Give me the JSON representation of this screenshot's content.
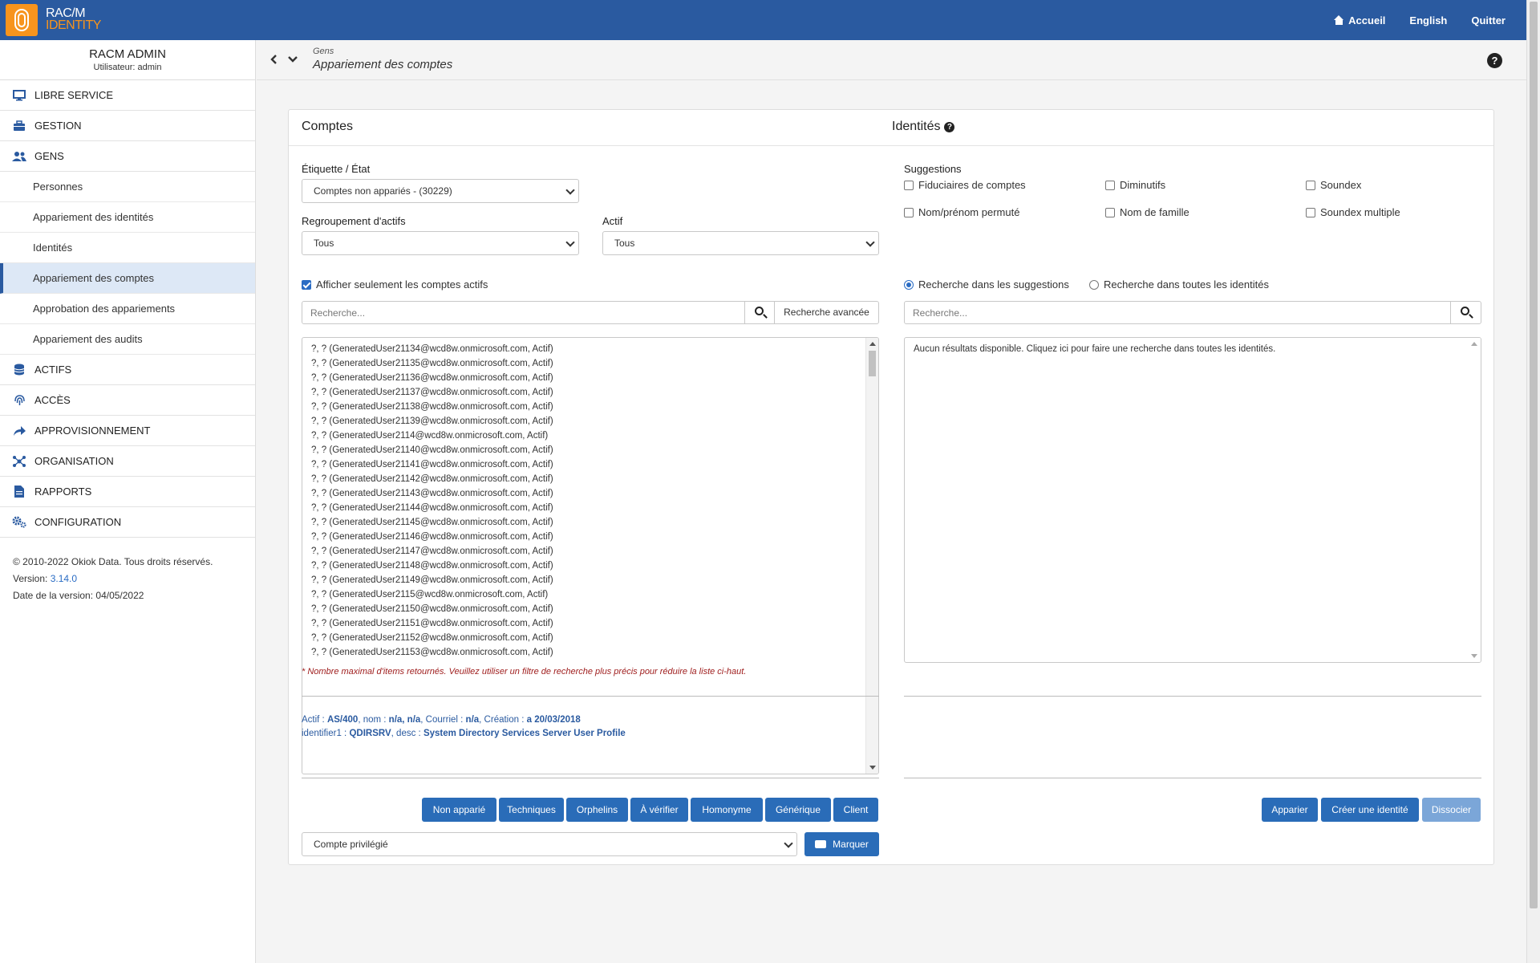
{
  "topbar": {
    "logo_line1": "RAC/M",
    "logo_line2": "IDENTITY",
    "nav": [
      {
        "label": "Accueil",
        "icon": "home-icon"
      },
      {
        "label": "English"
      },
      {
        "label": "Quitter"
      }
    ]
  },
  "user": {
    "name": "RACM ADMIN",
    "subtitle": "Utilisateur: admin"
  },
  "sidebar": {
    "menu_top": [
      {
        "label": "LIBRE SERVICE",
        "icon": "monitor-icon"
      },
      {
        "label": "GESTION",
        "icon": "briefcase-icon"
      },
      {
        "label": "GENS",
        "icon": "users-icon"
      }
    ],
    "gens_items": [
      {
        "label": "Personnes"
      },
      {
        "label": "Appariement des identités"
      },
      {
        "label": "Identités"
      },
      {
        "label": "Appariement des comptes",
        "active": true
      },
      {
        "label": "Approbation des appariements"
      },
      {
        "label": "Appariement des audits"
      }
    ],
    "menu_bottom": [
      {
        "label": "ACTIFS",
        "icon": "database-icon"
      },
      {
        "label": "ACCÈS",
        "icon": "fingerprint-icon"
      },
      {
        "label": "APPROVISIONNEMENT",
        "icon": "share-icon"
      },
      {
        "label": "ORGANISATION",
        "icon": "network-icon"
      },
      {
        "label": "RAPPORTS",
        "icon": "document-icon"
      },
      {
        "label": "CONFIGURATION",
        "icon": "gears-icon"
      }
    ],
    "footer": {
      "copyright": "© 2010-2022 Okiok Data. Tous droits réservés.",
      "version_label": "Version: ",
      "version": "3.14.0",
      "date": "Date de la version: 04/05/2022"
    }
  },
  "breadcrumb": {
    "parent": "Gens",
    "title": "Appariement des comptes"
  },
  "comptes": {
    "title": "Comptes",
    "etat_label": "Étiquette / État",
    "etat_value": "Comptes non appariés - (30229)",
    "regroupement_label": "Regroupement d'actifs",
    "regroupement_value": "Tous",
    "actif_label": "Actif",
    "actif_value": "Tous",
    "only_active_label": "Afficher seulement les comptes actifs",
    "search_placeholder": "Recherche...",
    "advanced_search": "Recherche avancée",
    "accounts": [
      "?, ? (GeneratedUser21134@wcd8w.onmicrosoft.com, Actif)",
      "?, ? (GeneratedUser21135@wcd8w.onmicrosoft.com, Actif)",
      "?, ? (GeneratedUser21136@wcd8w.onmicrosoft.com, Actif)",
      "?, ? (GeneratedUser21137@wcd8w.onmicrosoft.com, Actif)",
      "?, ? (GeneratedUser21138@wcd8w.onmicrosoft.com, Actif)",
      "?, ? (GeneratedUser21139@wcd8w.onmicrosoft.com, Actif)",
      "?, ? (GeneratedUser2114@wcd8w.onmicrosoft.com, Actif)",
      "?, ? (GeneratedUser21140@wcd8w.onmicrosoft.com, Actif)",
      "?, ? (GeneratedUser21141@wcd8w.onmicrosoft.com, Actif)",
      "?, ? (GeneratedUser21142@wcd8w.onmicrosoft.com, Actif)",
      "?, ? (GeneratedUser21143@wcd8w.onmicrosoft.com, Actif)",
      "?, ? (GeneratedUser21144@wcd8w.onmicrosoft.com, Actif)",
      "?, ? (GeneratedUser21145@wcd8w.onmicrosoft.com, Actif)",
      "?, ? (GeneratedUser21146@wcd8w.onmicrosoft.com, Actif)",
      "?, ? (GeneratedUser21147@wcd8w.onmicrosoft.com, Actif)",
      "?, ? (GeneratedUser21148@wcd8w.onmicrosoft.com, Actif)",
      "?, ? (GeneratedUser21149@wcd8w.onmicrosoft.com, Actif)",
      "?, ? (GeneratedUser2115@wcd8w.onmicrosoft.com, Actif)",
      "?, ? (GeneratedUser21150@wcd8w.onmicrosoft.com, Actif)",
      "?, ? (GeneratedUser21151@wcd8w.onmicrosoft.com, Actif)",
      "?, ? (GeneratedUser21152@wcd8w.onmicrosoft.com, Actif)",
      "?, ? (GeneratedUser21153@wcd8w.onmicrosoft.com, Actif)"
    ],
    "warning": "* Nombre maximal d'items retournés. Veuillez utiliser un filtre de recherche plus précis pour réduire la liste ci-haut.",
    "detail": {
      "actif_k": "Actif : ",
      "actif_v": "AS/400",
      "nom_k": ", nom : ",
      "nom_v": "n/a, n/a",
      "courriel_k": ", Courriel : ",
      "courriel_v": "n/a",
      "creation_k": ", Création : ",
      "creation_v": "a 20/03/2018",
      "line2_id_k": "identifier1 : ",
      "line2_id_v": "QDIRSRV",
      "desc_k": ", desc : ",
      "desc_v": "System Directory Services Server User Profile"
    },
    "buttons": [
      "Non apparié",
      "Techniques",
      "Orphelins",
      "À vérifier",
      "Homonyme",
      "Générique",
      "Client"
    ],
    "mark_select": "Compte privilégié",
    "mark_button": "Marquer"
  },
  "identites": {
    "title": "Identités",
    "suggestions_label": "Suggestions",
    "suggestions": [
      "Fiduciaires de comptes",
      "Diminutifs",
      "Soundex",
      "Nom/prénom permuté",
      "Nom de famille",
      "Soundex multiple"
    ],
    "radio_suggestions": "Recherche dans les suggestions",
    "radio_all": "Recherche dans toutes les identités",
    "search_placeholder": "Recherche...",
    "empty_message": "Aucun résultats disponible. Cliquez ici pour faire une recherche dans toutes les identités.",
    "buttons": [
      "Apparier",
      "Créer une identité",
      "Dissocier"
    ]
  },
  "colors": {
    "brand_blue": "#2a5aa0",
    "accent_orange": "#f7941d",
    "button_blue": "#2a6cb8"
  }
}
